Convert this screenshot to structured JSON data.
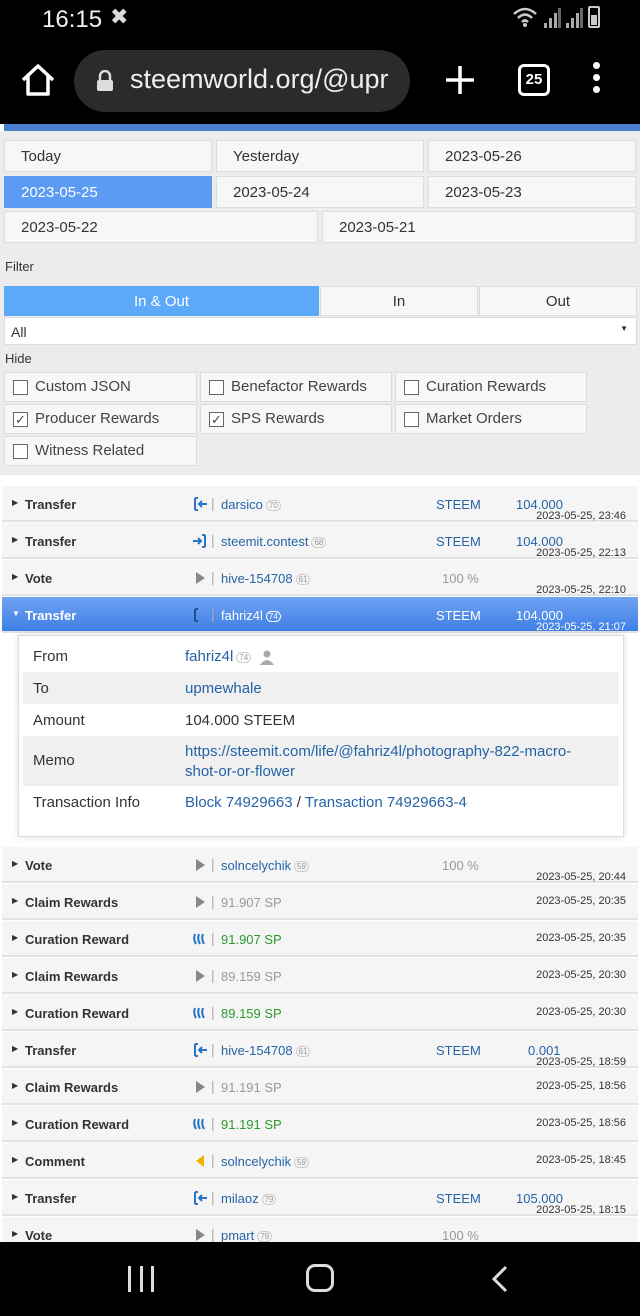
{
  "status": {
    "time": "16:15"
  },
  "browser": {
    "url": "steemworld.org/@upr",
    "tab_count": "25"
  },
  "dates": [
    "Today",
    "Yesterday",
    "2023-05-26",
    "2023-05-25",
    "2023-05-24",
    "2023-05-23",
    "2023-05-22",
    "2023-05-21"
  ],
  "filter": {
    "label": "Filter",
    "segments": [
      "In & Out",
      "In",
      "Out"
    ],
    "select_value": "All"
  },
  "hide": {
    "label": "Hide",
    "options": [
      {
        "label": "Custom JSON",
        "checked": false
      },
      {
        "label": "Benefactor Rewards",
        "checked": false
      },
      {
        "label": "Curation Rewards",
        "checked": false
      },
      {
        "label": "Producer Rewards",
        "checked": true
      },
      {
        "label": "SPS Rewards",
        "checked": true
      },
      {
        "label": "Market Orders",
        "checked": false
      },
      {
        "label": "Witness Related",
        "checked": false
      }
    ]
  },
  "rows": [
    {
      "type": "Transfer",
      "icon": "transfer-in-icon",
      "account": "darsico",
      "rep": "70",
      "asset": "STEEM",
      "amount": "104.000",
      "ts": "2023-05-25, 23:46"
    },
    {
      "type": "Transfer",
      "icon": "transfer-out-icon",
      "account": "steemit.contest",
      "rep": "68",
      "asset": "STEEM",
      "amount": "104.000",
      "ts": "2023-05-25, 22:13"
    },
    {
      "type": "Vote",
      "icon": "vote-icon",
      "account": "hive-154708",
      "rep": "61",
      "pct": "100 %",
      "ts": "2023-05-25, 22:10"
    },
    {
      "type": "Transfer",
      "icon": "transfer-in-icon",
      "account": "fahriz4l",
      "rep": "74",
      "asset": "STEEM",
      "amount": "104.000",
      "ts": "2023-05-25, 21:07"
    },
    {
      "type": "Vote",
      "icon": "vote-icon",
      "account": "solncelychik",
      "rep": "59",
      "pct": "100 %",
      "ts": "2023-05-25, 20:44"
    },
    {
      "type": "Claim Rewards",
      "icon": "claim-icon",
      "account": "91.907 SP",
      "ts": "2023-05-25, 20:35"
    },
    {
      "type": "Curation Reward",
      "icon": "steem-icon",
      "account": "91.907 SP",
      "ts": "2023-05-25, 20:35"
    },
    {
      "type": "Claim Rewards",
      "icon": "claim-icon",
      "account": "89.159 SP",
      "ts": "2023-05-25, 20:30"
    },
    {
      "type": "Curation Reward",
      "icon": "steem-icon",
      "account": "89.159 SP",
      "ts": "2023-05-25, 20:30"
    },
    {
      "type": "Transfer",
      "icon": "transfer-in-icon",
      "account": "hive-154708",
      "rep": "61",
      "asset": "STEEM",
      "amount": "0.001",
      "ts": "2023-05-25, 18:59"
    },
    {
      "type": "Claim Rewards",
      "icon": "claim-icon",
      "account": "91.191 SP",
      "ts": "2023-05-25, 18:56"
    },
    {
      "type": "Curation Reward",
      "icon": "steem-icon",
      "account": "91.191 SP",
      "ts": "2023-05-25, 18:56"
    },
    {
      "type": "Comment",
      "icon": "comment-icon",
      "account": "solncelychik",
      "rep": "59",
      "ts": "2023-05-25, 18:45"
    },
    {
      "type": "Transfer",
      "icon": "transfer-in-icon",
      "account": "milaoz",
      "rep": "79",
      "asset": "STEEM",
      "amount": "105.000",
      "ts": "2023-05-25, 18:15"
    },
    {
      "type": "Vote",
      "icon": "vote-icon",
      "account": "pmart",
      "rep": "79",
      "pct": "100 %",
      "ts": ""
    }
  ],
  "detail": {
    "from_label": "From",
    "from": "fahriz4l",
    "from_rep": "74",
    "to_label": "To",
    "to": "upmewhale",
    "amount_label": "Amount",
    "amount": "104.000 STEEM",
    "memo_label": "Memo",
    "memo_line1": "https://steemit.com/life/@fahriz4l/photography-822-macro-",
    "memo_line2": "shot-or-or-flower",
    "tx_label": "Transaction Info",
    "block": "Block 74929663",
    "slash": "/",
    "tx": "Transaction 74929663-4"
  }
}
